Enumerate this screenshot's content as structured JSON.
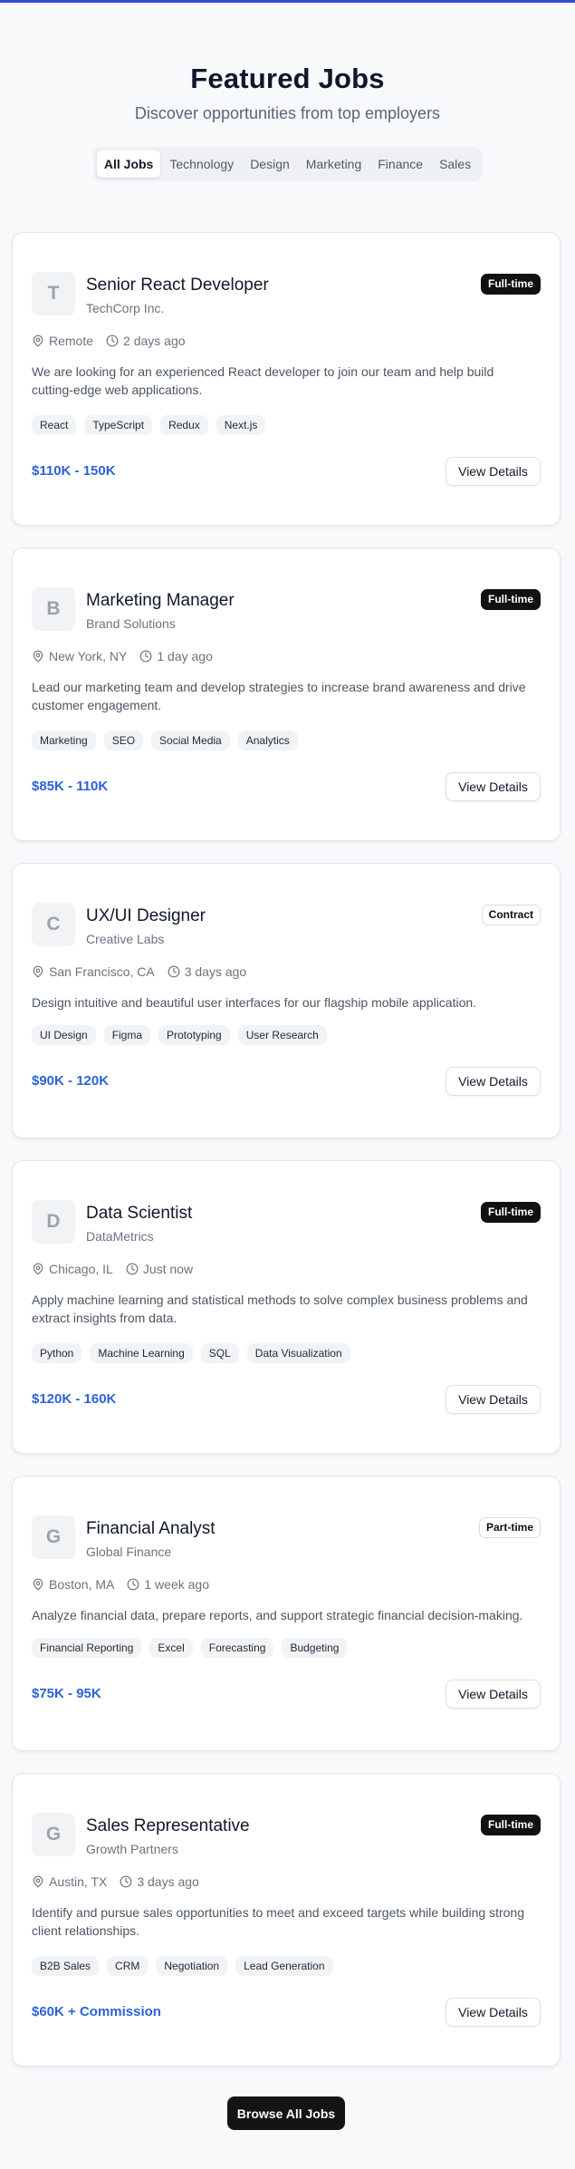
{
  "header": {
    "title": "Featured Jobs",
    "subtitle": "Discover opportunities from top employers"
  },
  "tabs": [
    {
      "label": "All Jobs",
      "active": true
    },
    {
      "label": "Technology",
      "active": false
    },
    {
      "label": "Design",
      "active": false
    },
    {
      "label": "Marketing",
      "active": false
    },
    {
      "label": "Finance",
      "active": false
    },
    {
      "label": "Sales",
      "active": false
    }
  ],
  "jobs": [
    {
      "logo_letter": "T",
      "title": "Senior React Developer",
      "company": "TechCorp Inc.",
      "type": "Full-time",
      "location": "Remote",
      "posted": "2 days ago",
      "description": "We are looking for an experienced React developer to join our team and help build cutting-edge web applications.",
      "tags": [
        "React",
        "TypeScript",
        "Redux",
        "Next.js"
      ],
      "salary": "$110K - 150K",
      "button": "View Details"
    },
    {
      "logo_letter": "B",
      "title": "Marketing Manager",
      "company": "Brand Solutions",
      "type": "Full-time",
      "location": "New York, NY",
      "posted": "1 day ago",
      "description": "Lead our marketing team and develop strategies to increase brand awareness and drive customer engagement.",
      "tags": [
        "Marketing",
        "SEO",
        "Social Media",
        "Analytics"
      ],
      "salary": "$85K - 110K",
      "button": "View Details"
    },
    {
      "logo_letter": "C",
      "title": "UX/UI Designer",
      "company": "Creative Labs",
      "type": "Contract",
      "location": "San Francisco, CA",
      "posted": "3 days ago",
      "description": "Design intuitive and beautiful user interfaces for our flagship mobile application.",
      "tags": [
        "UI Design",
        "Figma",
        "Prototyping",
        "User Research"
      ],
      "salary": "$90K - 120K",
      "button": "View Details"
    },
    {
      "logo_letter": "D",
      "title": "Data Scientist",
      "company": "DataMetrics",
      "type": "Full-time",
      "location": "Chicago, IL",
      "posted": "Just now",
      "description": "Apply machine learning and statistical methods to solve complex business problems and extract insights from data.",
      "tags": [
        "Python",
        "Machine Learning",
        "SQL",
        "Data Visualization"
      ],
      "salary": "$120K - 160K",
      "button": "View Details"
    },
    {
      "logo_letter": "G",
      "title": "Financial Analyst",
      "company": "Global Finance",
      "type": "Part-time",
      "location": "Boston, MA",
      "posted": "1 week ago",
      "description": "Analyze financial data, prepare reports, and support strategic financial decision-making.",
      "tags": [
        "Financial Reporting",
        "Excel",
        "Forecasting",
        "Budgeting"
      ],
      "salary": "$75K - 95K",
      "button": "View Details"
    },
    {
      "logo_letter": "G",
      "title": "Sales Representative",
      "company": "Growth Partners",
      "type": "Full-time",
      "location": "Austin, TX",
      "posted": "3 days ago",
      "description": "Identify and pursue sales opportunities to meet and exceed targets while building strong client relationships.",
      "tags": [
        "B2B Sales",
        "CRM",
        "Negotiation",
        "Lead Generation"
      ],
      "salary": "$60K + Commission",
      "button": "View Details"
    }
  ],
  "footer": {
    "browse_label": "Browse All Jobs"
  },
  "colors": {
    "accent": "#2d63d6",
    "top_bar": "#2d4fd6",
    "badge_dark": "#111111"
  }
}
